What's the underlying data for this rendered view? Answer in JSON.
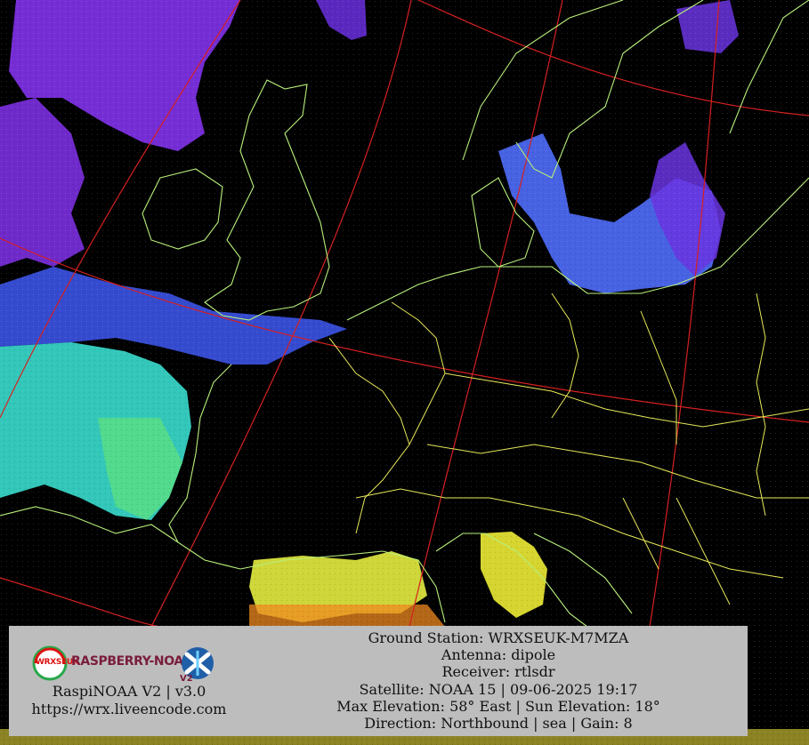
{
  "image": {
    "type": "weather-satellite-image",
    "colors": {
      "background": "#000000",
      "coastline": "#b8f07a",
      "borders": "#e8e85a",
      "graticule": "#d62020",
      "cloud_purple": "#8a2be2",
      "cloud_blue": "#4a6cf0",
      "cloud_cyan": "#3fe0c8",
      "cloud_yellow": "#e6e33a",
      "panel": "#bdbdbd"
    }
  },
  "footer": {
    "brand": {
      "wrx_logo_text": "WRXSEUK",
      "raspberry_logo_text": "RASPBERRY-NOAA",
      "version_badge": "V2",
      "product": "RaspiNOAA V2 | v3.0",
      "url": "https://wrx.liveencode.com"
    },
    "station": {
      "ground_station": "Ground Station: WRXSEUK-M7MZA",
      "antenna": "Antenna: dipole",
      "receiver": "Receiver: rtlsdr",
      "satellite": "Satellite: NOAA 15 | 09-06-2025 19:17",
      "elevation": "Max Elevation: 58° East | Sun Elevation: 18°",
      "direction": "Direction: Northbound | sea | Gain: 8"
    }
  }
}
